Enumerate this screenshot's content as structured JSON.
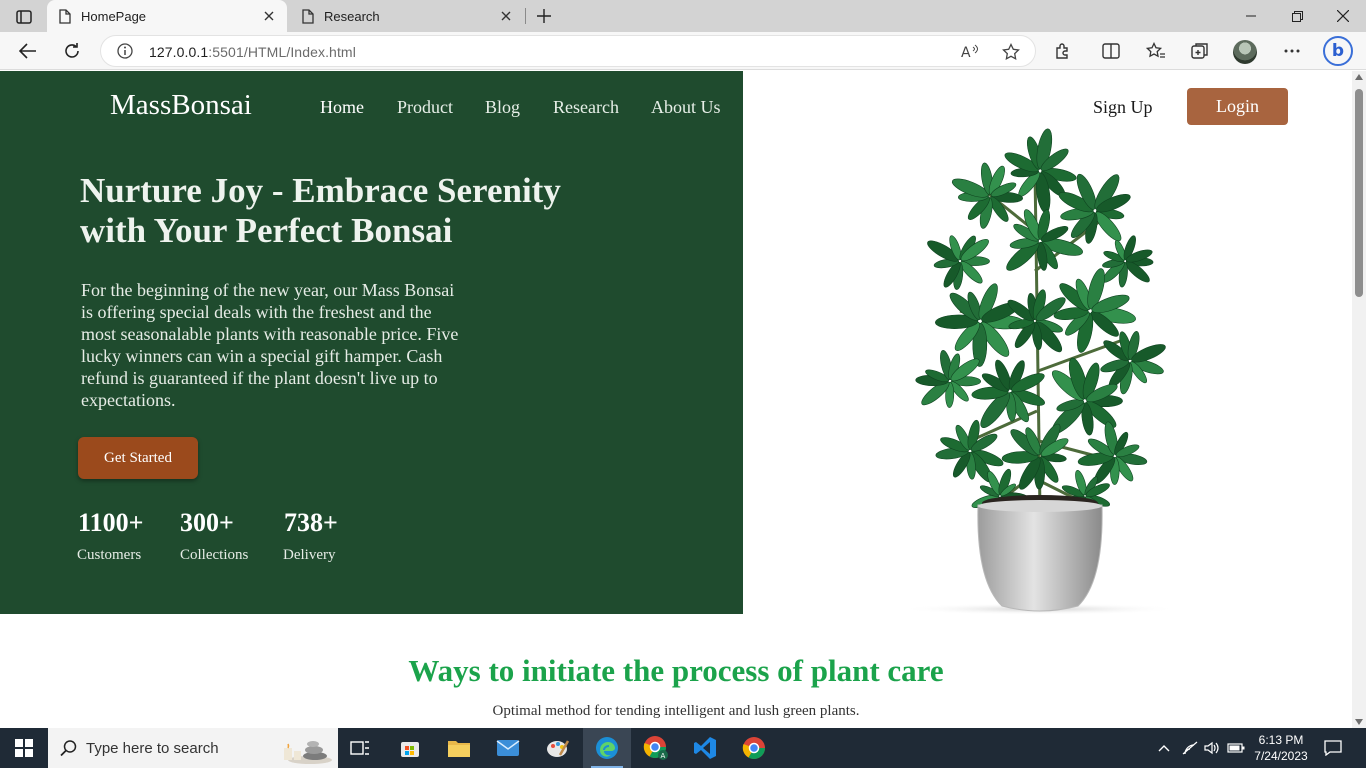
{
  "browser": {
    "tabs": [
      {
        "title": "HomePage",
        "active": true
      },
      {
        "title": "Research",
        "active": false
      }
    ],
    "url_host": "127.0.0.1",
    "url_rest": ":5501/HTML/Index.html"
  },
  "site": {
    "brand": "MassBonsai",
    "nav": [
      "Home",
      "Product",
      "Blog",
      "Research",
      "About Us"
    ],
    "signup": "Sign Up",
    "login": "Login"
  },
  "hero": {
    "title_line1": "Nurture Joy - Embrace Serenity",
    "title_line2": "with Your Perfect Bonsai",
    "description": "For the beginning of the new year, our Mass Bonsai is offering special deals with the freshest and the most seasonalable plants with reasonable price. Five lucky winners can win a special gift hamper. Cash refund is guaranteed if the plant doesn't live up to expectations.",
    "cta": "Get Started",
    "stats": [
      {
        "value": "1100+",
        "label": "Customers"
      },
      {
        "value": "300+",
        "label": "Collections"
      },
      {
        "value": "738+",
        "label": "Delivery"
      }
    ]
  },
  "section": {
    "title": "Ways to initiate the process of plant care",
    "subtitle": "Optimal method for tending intelligent and lush green plants."
  },
  "taskbar": {
    "search_placeholder": "Type here to search",
    "time": "6:13 PM",
    "date": "7/24/2023"
  },
  "colors": {
    "hero_bg": "#1f4b2e",
    "cta": "#9b4a1c",
    "login": "#a8643f",
    "section_title": "#1ba34b"
  }
}
